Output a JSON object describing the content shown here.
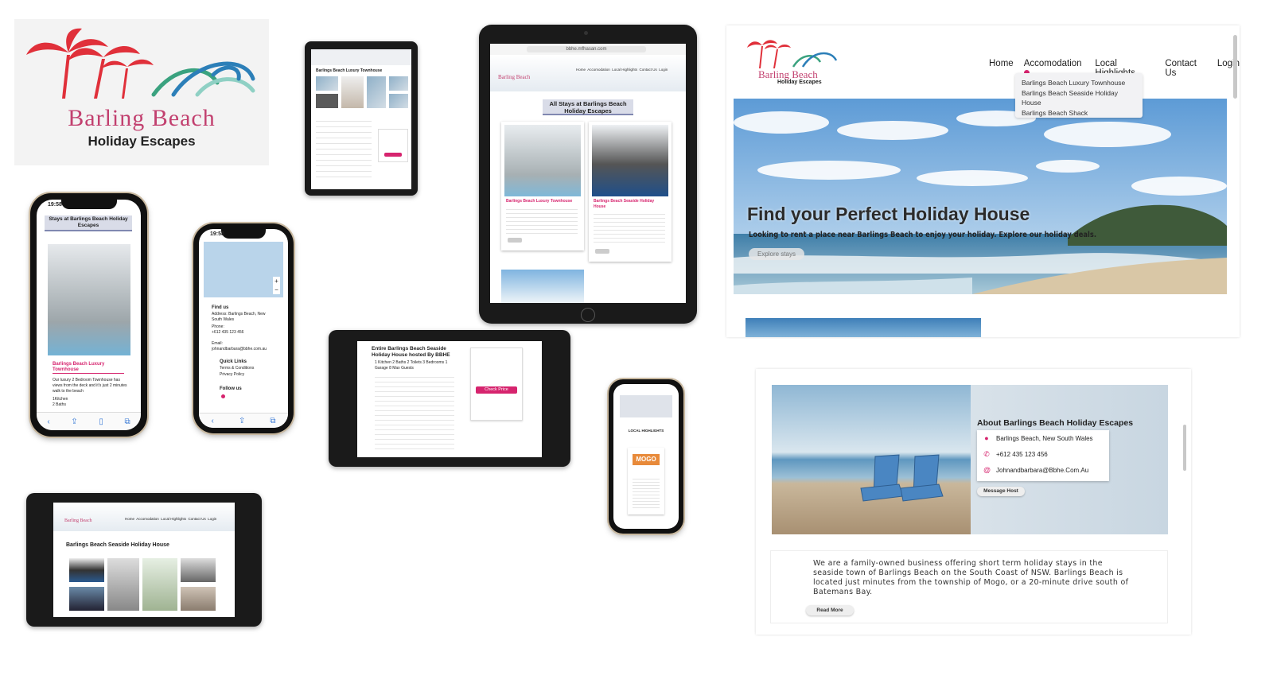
{
  "brand": {
    "name": "Barling Beach",
    "tagline": "Holiday Escapes"
  },
  "desktop": {
    "nav": [
      "Home",
      "Accomodation",
      "Local Highlights",
      "Contact Us",
      "Login"
    ],
    "dropdown": [
      "Barlings Beach Luxury Townhouse",
      "Barlings Beach Seaside Holiday House",
      "Barlings Beach Shack"
    ],
    "hero_title": "Find your Perfect Holiday House",
    "hero_subtitle": "Looking to rent a place near Barlings Beach to enjoy your holiday. Explore our holiday deals.",
    "hero_button": "Explore stays"
  },
  "about": {
    "title": "About Barlings Beach Holiday Escapes",
    "location": "Barlings Beach, New South Wales",
    "phone": "+612 435 123 456",
    "email": "Johnandbarbara@Bbhe.Com.Au",
    "message_button": "Message Host",
    "description": "We are a family-owned business offering short term holiday stays in the seaside town of Barlings Beach on the South Coast of NSW. Barlings Beach is located just minutes from the township of Mogo, or a 20-minute drive south of Batemans Bay.",
    "read_more": "Read More"
  },
  "tablet_all_stays": {
    "url": "bbhe.mfhasan.com",
    "nav": "Home  Accomodation  Local Highlights  Contact Us  Login",
    "heading": "All Stays at Barlings Beach Holiday Escapes",
    "card1_title": "Barlings Beach Luxury Townhouse",
    "card2_title": "Barlings Beach Seaside Holiday House"
  },
  "phone_stays": {
    "time": "19:58",
    "heading": "Stays at Barlings Beach Holiday Escapes",
    "card_title": "Barlings Beach Luxury Townhouse",
    "card_text": "Our luxury 2 Bedroom Townhouse has views from the deck and it's just 2 minutes walk to the beach",
    "amenity1": "1Kitchen",
    "amenity2": "2 Baths"
  },
  "phone_contact": {
    "time": "19:58",
    "find_us": "Find us",
    "address": "Address: Barlings Beach, New South Wales",
    "phone_label": "Phone:",
    "phone": "+612 435 123 456",
    "email_label": "Email:",
    "email": "johnandbarbara@bbhe.com.au",
    "quick_links": "Quick Links",
    "link1": "Terms & Conditions",
    "link2": "Privacy Policy",
    "follow": "Follow us"
  },
  "tablet_seaside": {
    "title": "Barlings Beach Seaside Holiday House",
    "nav": "Home  Accomodation  Local Highlights  Contact Us  Login"
  },
  "tablet_booking": {
    "title": "Entire Barlings Beach Seaside Holiday House hosted By BBHE",
    "features": "1 Kitchen  2 Baths  2 Toilets  3 Bedrooms  1 Garage  8 Max Guests",
    "check_price": "Check Price"
  },
  "phone_highlights": {
    "heading": "LOCAL HIGHLIGHTS",
    "logo": "MOGO"
  }
}
